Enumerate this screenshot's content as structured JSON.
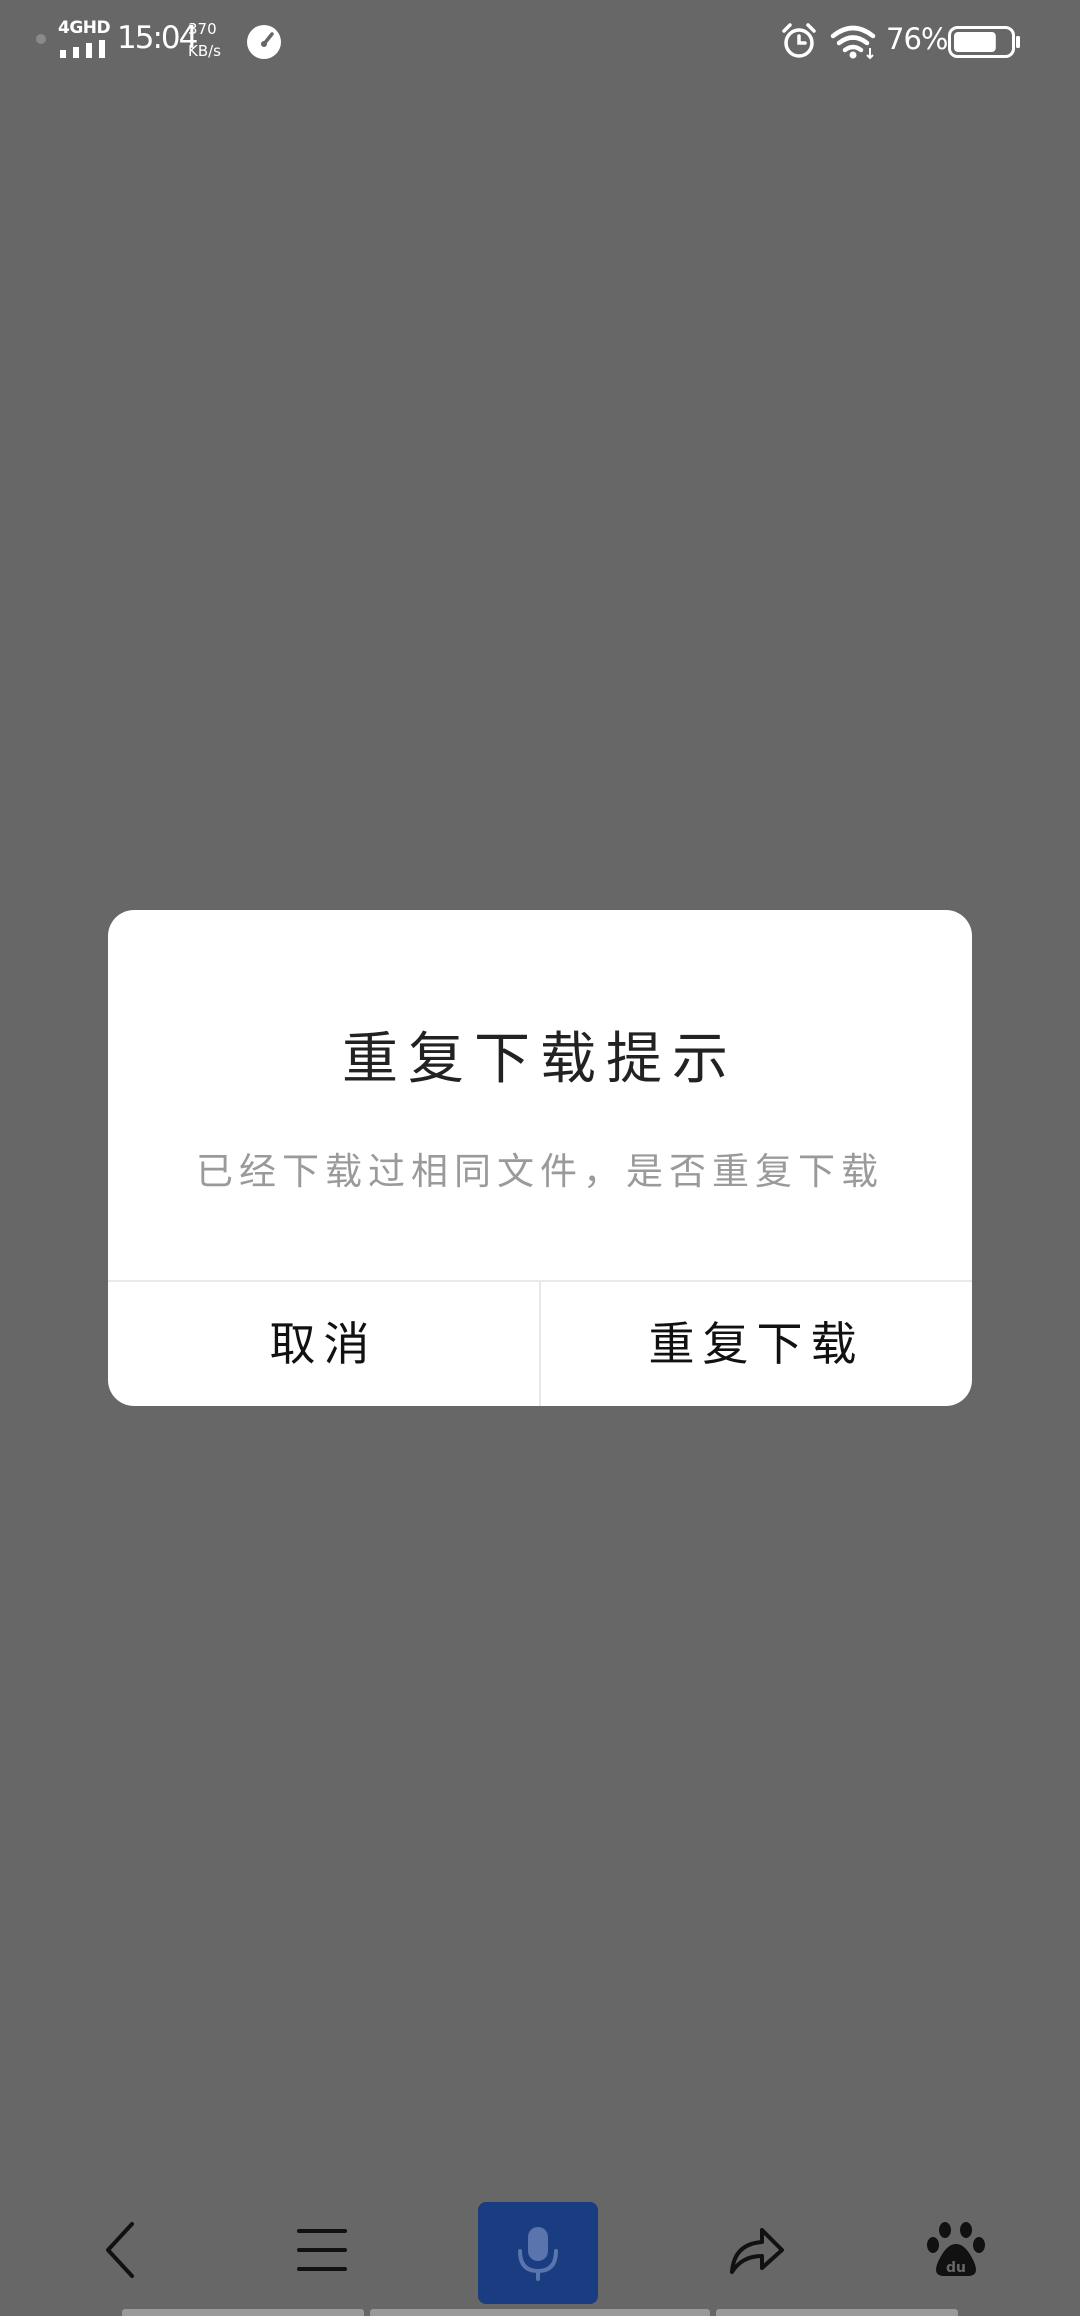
{
  "status_bar": {
    "network_label": "4GHD",
    "time": "15:04",
    "speed_value": "370",
    "speed_unit": "KB/s",
    "battery_percent": "76%",
    "battery_level": 0.76,
    "icons": [
      "signal-icon",
      "speedometer-icon",
      "alarm-icon",
      "wifi-icon",
      "battery-icon"
    ]
  },
  "dialog": {
    "title": "重复下载提示",
    "message": "已经下载过相同文件，是否重复下载",
    "cancel_label": "取消",
    "confirm_label": "重复下载"
  },
  "toolbar": {
    "items": [
      "back-icon",
      "menu-icon",
      "microphone-icon",
      "share-icon",
      "baidu-paw-icon"
    ],
    "voice_button_color": "#1a3c80"
  },
  "colors": {
    "overlay": "#676767",
    "dialog_bg": "#ffffff",
    "title_text": "#222222",
    "message_text": "#9a9a9a"
  }
}
